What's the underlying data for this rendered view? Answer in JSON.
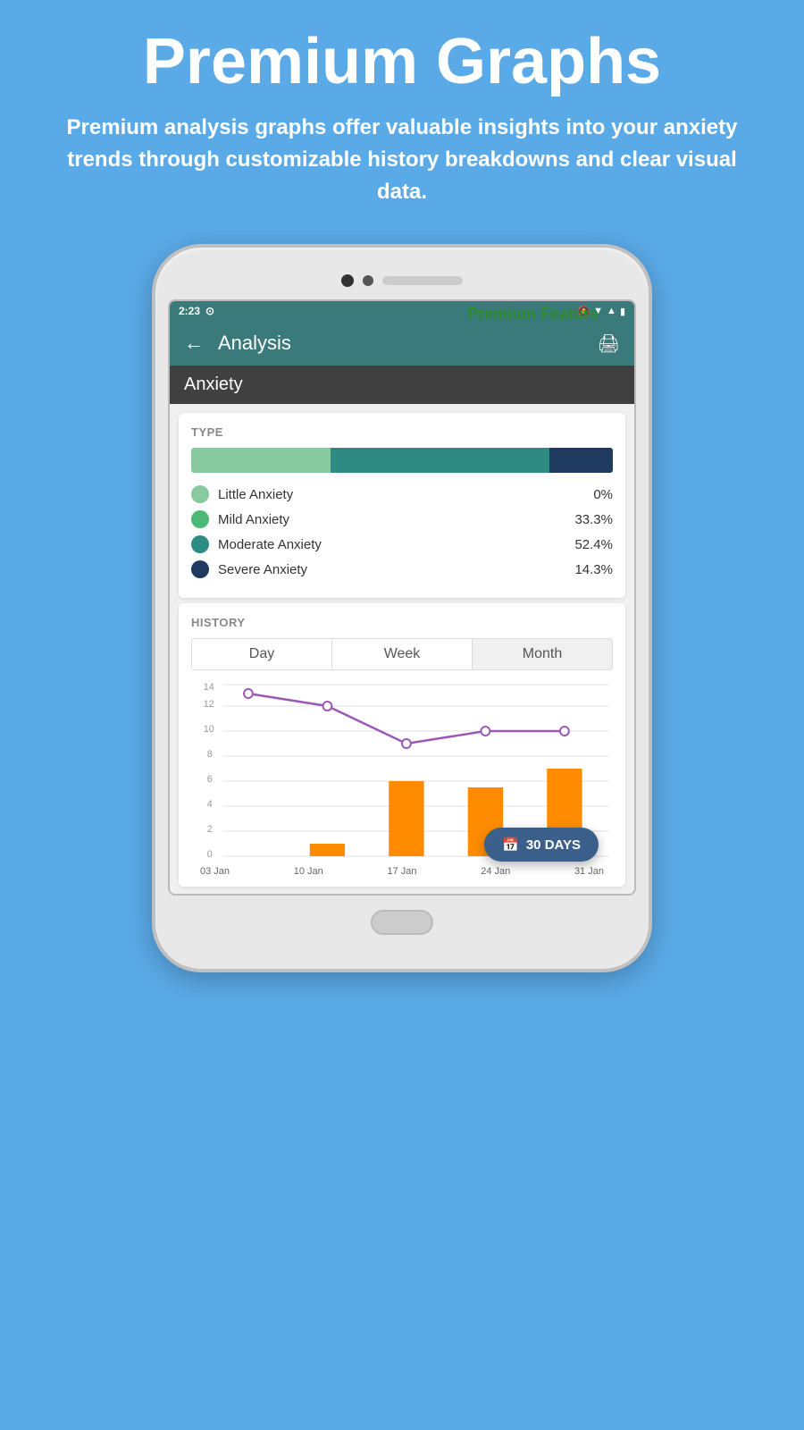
{
  "page": {
    "background_color": "#5BAAE8",
    "main_title": "Premium Graphs",
    "subtitle": "Premium analysis graphs offer valuable insights into your anxiety trends through customizable history breakdowns and clear visual data.",
    "premium_label": "Premium Feature"
  },
  "status_bar": {
    "time": "2:23",
    "icons_right": "🔇 ▾ 📶 🔋"
  },
  "app_bar": {
    "title": "Analysis",
    "back_icon": "←",
    "print_icon": "🖨"
  },
  "section_title": "Anxiety",
  "type_section": {
    "label": "TYPE",
    "bars": [
      {
        "color": "#88C9A0",
        "width": 33,
        "name": "little"
      },
      {
        "color": "#2E8B84",
        "width": 52,
        "name": "moderate"
      },
      {
        "color": "#1E3A5F",
        "width": 15,
        "name": "severe"
      }
    ],
    "legend": [
      {
        "label": "Little Anxiety",
        "value": "0%",
        "color": "#88C9A0"
      },
      {
        "label": "Mild Anxiety",
        "value": "33.3%",
        "color": "#4CB878"
      },
      {
        "label": "Moderate Anxiety",
        "value": "52.4%",
        "color": "#2E8B84"
      },
      {
        "label": "Severe Anxiety",
        "value": "14.3%",
        "color": "#1E3A5F"
      }
    ]
  },
  "history_section": {
    "label": "HISTORY",
    "tabs": [
      {
        "label": "Day",
        "active": false
      },
      {
        "label": "Week",
        "active": false
      },
      {
        "label": "Month",
        "active": true
      }
    ],
    "chart": {
      "y_max": 14,
      "y_labels": [
        0,
        2,
        4,
        6,
        8,
        10,
        12,
        14
      ],
      "x_labels": [
        "03 Jan",
        "10 Jan",
        "17 Jan",
        "24 Jan",
        "31 Jan"
      ],
      "bars": [
        {
          "x_label": "03 Jan",
          "value": 0
        },
        {
          "x_label": "10 Jan",
          "value": 1
        },
        {
          "x_label": "17 Jan",
          "value": 6
        },
        {
          "x_label": "24 Jan",
          "value": 5.5
        },
        {
          "x_label": "31 Jan",
          "value": 7
        }
      ],
      "line_points": [
        {
          "x_label": "03 Jan",
          "value": 13
        },
        {
          "x_label": "10 Jan",
          "value": 12
        },
        {
          "x_label": "17 Jan",
          "value": 9
        },
        {
          "x_label": "24 Jan",
          "value": 10
        },
        {
          "x_label": "31 Jan",
          "value": 10
        }
      ],
      "bar_color": "#FF8C00",
      "line_color": "#9B59B6"
    },
    "floating_button": {
      "label": "30 DAYS",
      "icon": "📅"
    }
  }
}
